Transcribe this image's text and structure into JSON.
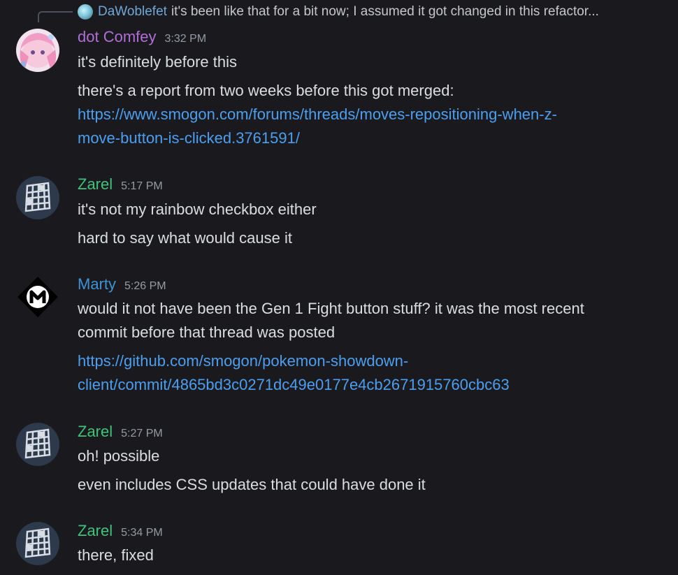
{
  "reply": {
    "author": "DaWoblefet",
    "text": "it's been like that for a bit now; I assumed it got changed in this refactor..."
  },
  "messages": [
    {
      "author": "dot Comfey",
      "author_color": "#b16fd6",
      "time": "3:32 PM",
      "lines": [
        "it's definitely before this",
        "there's a report from two weeks before this got merged:",
        "https://www.smogon.com/forums/threads/moves-repositioning-when-z-",
        "move-button-is-clicked.3761591/"
      ]
    },
    {
      "author": "Zarel",
      "author_color": "#3ec47a",
      "time": "5:17 PM",
      "lines": [
        "it's not my rainbow checkbox either",
        "hard to say what would cause it"
      ]
    },
    {
      "author": "Marty",
      "author_color": "#3d93d6",
      "time": "5:26 PM",
      "lines": [
        "would it not have been the Gen 1 Fight button stuff? it was the most recent",
        "commit before that thread was posted",
        "https://github.com/smogon/pokemon-showdown-",
        "client/commit/4865bd3c0271dc49e0177e4cb2671915760cbc63"
      ]
    },
    {
      "author": "Zarel",
      "author_color": "#3ec47a",
      "time": "5:27 PM",
      "lines": [
        "oh! possible",
        "even includes CSS updates that could have done it"
      ]
    },
    {
      "author": "Zarel",
      "author_color": "#3ec47a",
      "time": "5:34 PM",
      "lines": [
        "there, fixed"
      ]
    }
  ]
}
